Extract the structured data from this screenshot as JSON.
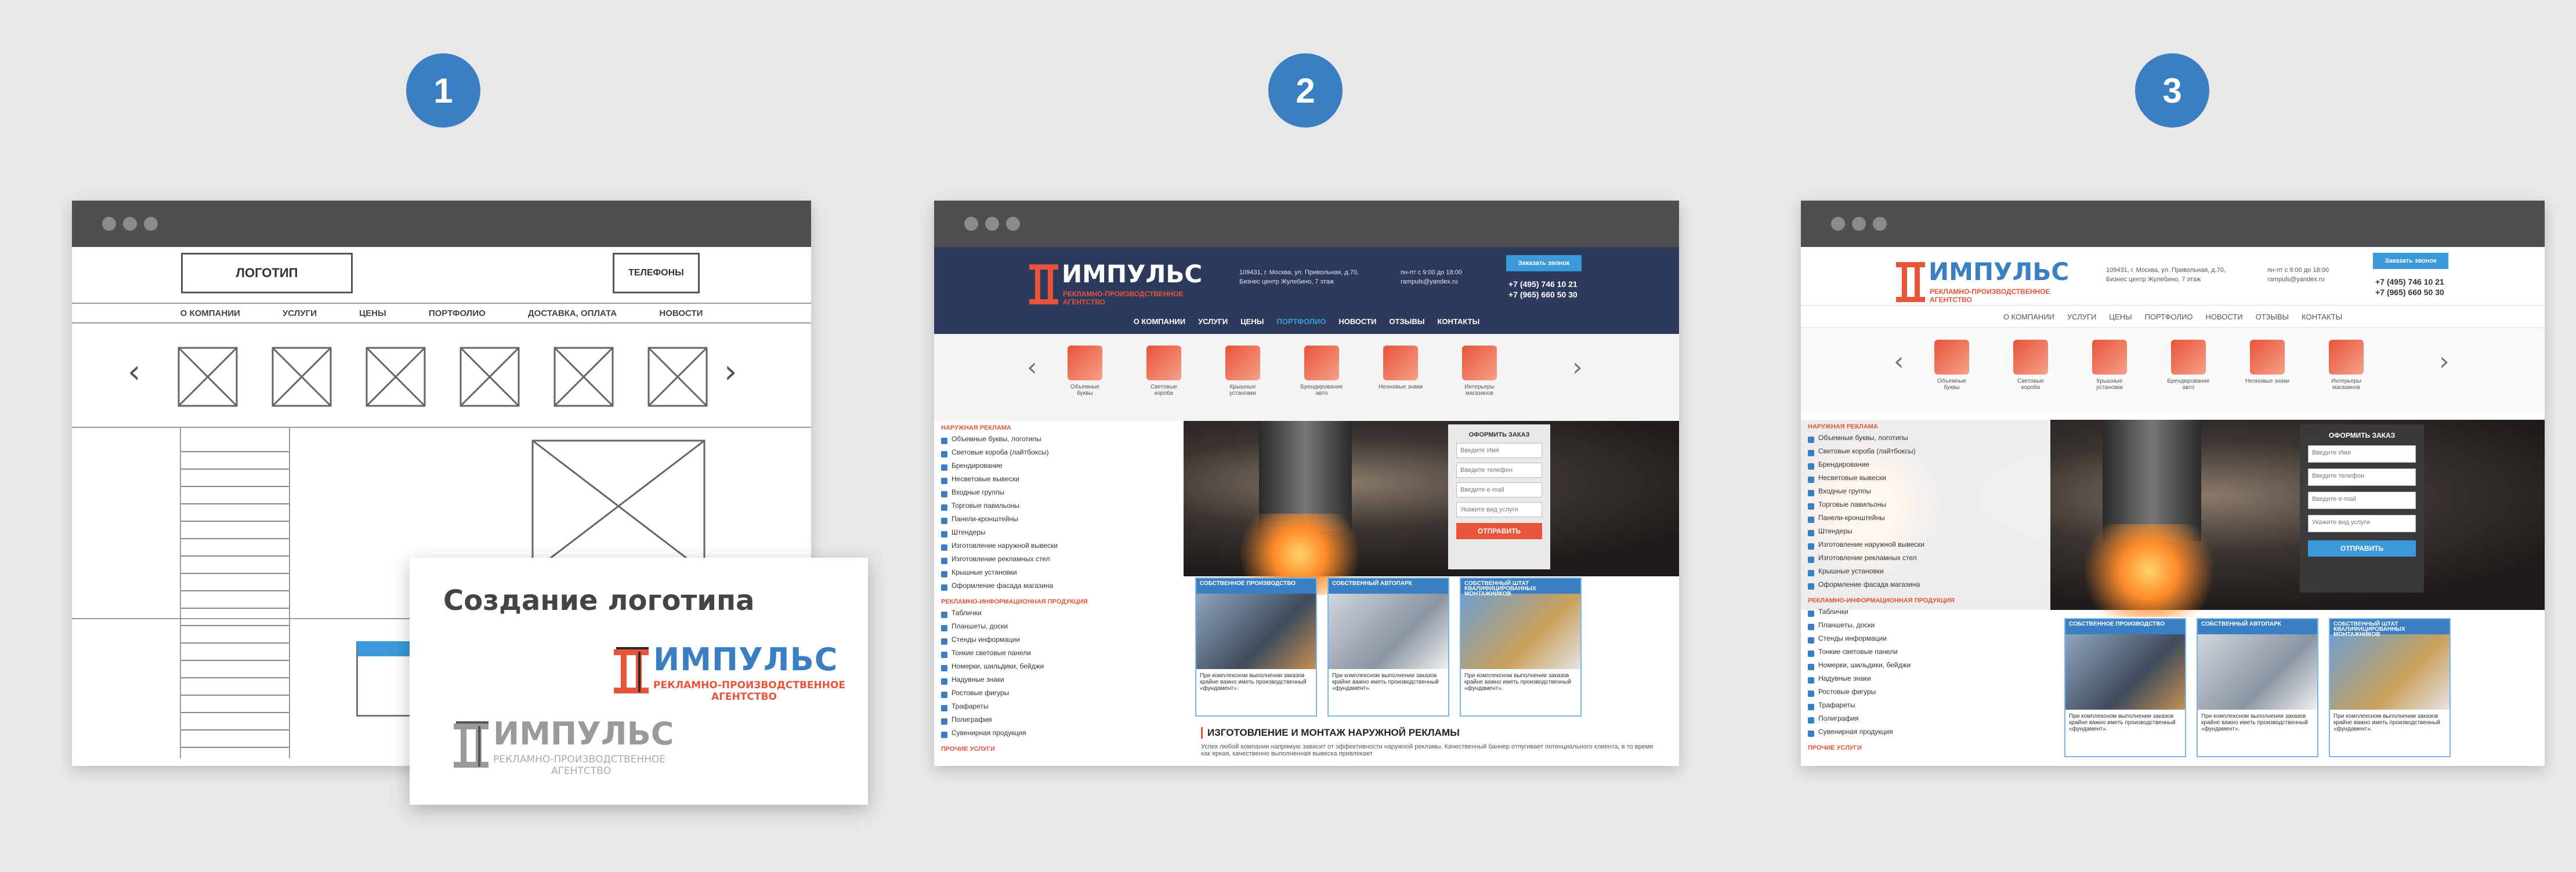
{
  "steps": [
    "1",
    "2",
    "3"
  ],
  "wireframe": {
    "logo_label": "ЛОГОТИП",
    "phones_label": "ТЕЛЕФОНЫ",
    "nav": [
      "О КОМПАНИИ",
      "УСЛУГИ",
      "ЦЕНЫ",
      "ПОРТФОЛИО",
      "ДОСТАВКА, ОПЛАТА",
      "НОВОСТИ"
    ]
  },
  "card": {
    "title": "Создание логотипа",
    "brand": "ИМПУЛЬС",
    "tagline_1": "РЕКЛАМНО-ПРОИЗВОДСТВЕННОЕ",
    "tagline_2": "АГЕНТСТВО"
  },
  "site": {
    "brand": "ИМПУЛЬС",
    "tagline": "РЕКЛАМНО-ПРОИЗВОДСТВЕННОЕ АГЕНТСТВО",
    "address_1": "109431, г. Москва, ул. Привольная, д.70,",
    "address_2": "Бизнес центр Жулебино, 7 этаж",
    "hours": "пн-пт с 9:00 до 18:00",
    "email": "rampuls@yandex.ru",
    "phone_1": "+7 (495) 746 10 21",
    "phone_2": "+7 (965) 660 50 30",
    "order_button": "Заказать звонок",
    "nav": [
      "О КОМПАНИИ",
      "УСЛУГИ",
      "ЦЕНЫ",
      "ПОРТФОЛИО",
      "НОВОСТИ",
      "ОТЗЫВЫ",
      "КОНТАКТЫ"
    ],
    "categories": [
      "Объемные буквы",
      "Световые короба",
      "Крышные установки",
      "Брендирование авто",
      "Неоновые знаки",
      "Интерьеры магазинов"
    ],
    "sidebar_head_1": "НАРУЖНАЯ РЕКЛАМА",
    "sidebar_1": [
      "Объемные буквы, логотипы",
      "Световые короба (лайтбоксы)",
      "Брендирование",
      "Несветовые вывески",
      "Входные группы",
      "Торговые павильоны",
      "Панели-кронштейны",
      "Штендеры",
      "Изготовление наружной вывески",
      "Изготовление рекламных стел",
      "Крышные установки",
      "Оформление фасада магазина"
    ],
    "sidebar_head_2": "РЕКЛАМНО-ИНФОРМАЦИОННАЯ ПРОДУКЦИЯ",
    "sidebar_2": [
      "Таблички",
      "Планшеты, доски",
      "Стенды информации",
      "Тонкие световые панели",
      "Номерки, шильдики, бейджи",
      "Надувные знаки",
      "Ростовые фигуры",
      "Трафареты",
      "Полиграфия",
      "Сувенирная продукция"
    ],
    "sidebar_head_3": "ПРОЧИЕ УСЛУГИ",
    "form_title": "ОФОРМИТЬ ЗАКАЗ",
    "form_fields": [
      "Введите Имя",
      "Введите телефон",
      "Введите e-mail",
      "Укажите вид услуги"
    ],
    "form_submit": "ОТПРАВИТЬ",
    "promos": [
      {
        "title": "СОБСТВЕННОЕ ПРОИЗВОДСТВО",
        "text": "При комплексном выполнении заказов крайне важно иметь производственный «фундамент»."
      },
      {
        "title": "СОБСТВЕННЫЙ АВТОПАРК",
        "text": "При комплексном выполнении заказов крайне важно иметь производственный «фундамент»."
      },
      {
        "title": "СОБСТВЕННЫЙ ШТАТ КВАЛИФИЦИРОВАННЫХ МОНТАЖНИКОВ",
        "text": "При комплексном выполнении заказов крайне важно иметь производственный «фундамент»."
      }
    ],
    "heading": "ИЗГОТОВЛЕНИЕ И МОНТАЖ НАРУЖНОЙ РЕКЛАМЫ",
    "para": "Успех любой компании напрямую зависит от эффективности наружной рекламы. Качественный баннер отпугивает потенциального клиента, в то время как яркая, качественно выполненная вывеска привлекает"
  },
  "colors": {
    "badge": "#3a7fc4",
    "accent": "#e8543a",
    "navy": "#2d3a5c",
    "blue": "#3a7fc4"
  }
}
